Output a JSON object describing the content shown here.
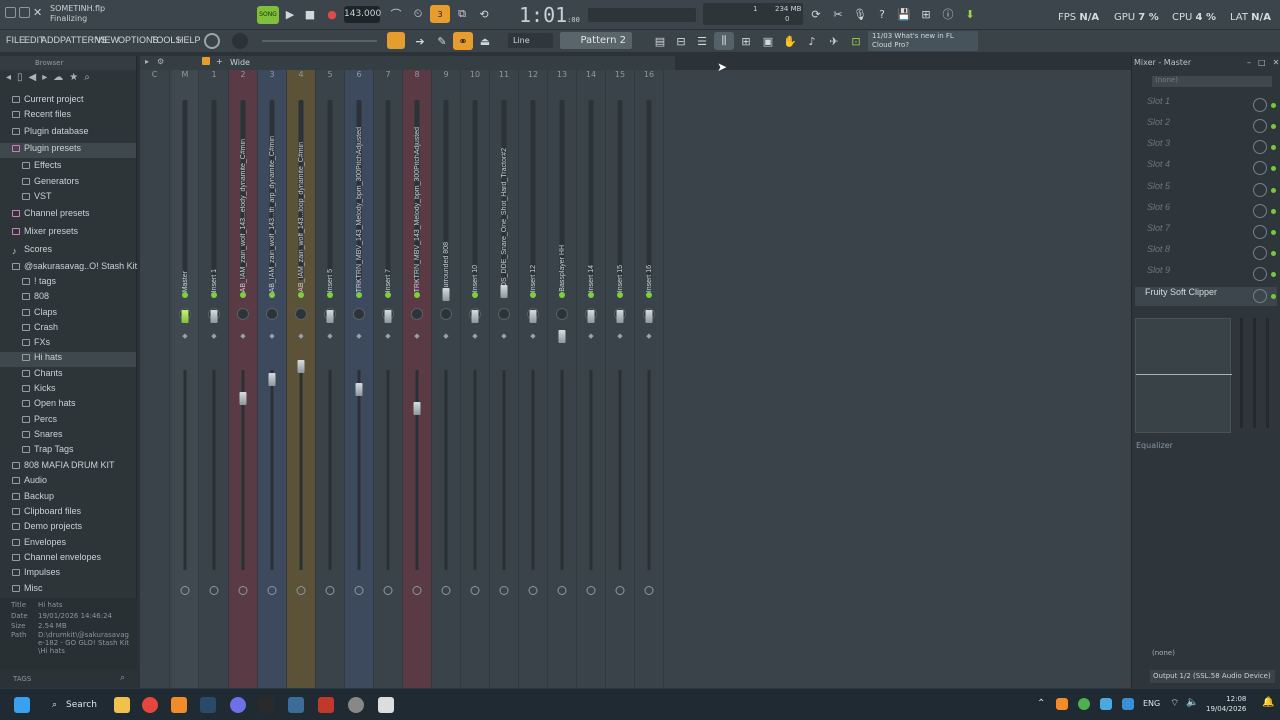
{
  "title": {
    "project": "SOMETINH.flp",
    "status": "Finalizing"
  },
  "transport": {
    "song_label": "SONG",
    "tempo": "143.000",
    "time": "1:01",
    "time_small": ":00",
    "cpu_value": "1",
    "mem": "234 MB",
    "voices": "0"
  },
  "meters": {
    "fps_label": "FPS",
    "fps": "N/A",
    "gpu_label": "GPU",
    "gpu": "7 %",
    "cpu_label": "CPU",
    "cpu": "4 %",
    "lat_label": "LAT",
    "lat": "N/A"
  },
  "menus": [
    "FILE",
    "EDIT",
    "ADD",
    "PATTERNS",
    "VIEW",
    "OPTIONS",
    "TOOLS",
    "HELP"
  ],
  "toolbar": {
    "snap": "Line",
    "pattern": "Pattern 2",
    "news_date": "11/03",
    "news_title": "What's new in FL",
    "news_sub": "Cloud Pro?"
  },
  "browser": {
    "title": "Browser",
    "items": [
      "Current project",
      "Recent files",
      "Plugin database",
      "Plugin presets",
      "Effects",
      "Generators",
      "VST",
      "Channel presets",
      "Mixer presets",
      "Scores",
      "@sakurasavag..O! Stash Kit",
      "! tags",
      "808",
      "Claps",
      "Crash",
      "FXs",
      "Hi hats",
      "Chants",
      "Kicks",
      "Open hats",
      "Percs",
      "Snares",
      "Trap Tags",
      "808 MAFIA DRUM KIT",
      "Audio",
      "Backup",
      "Clipboard files",
      "Demo projects",
      "Envelopes",
      "Channel envelopes",
      "Impulses",
      "Misc"
    ],
    "info": {
      "title_label": "Title",
      "title": "Hi hats",
      "date_label": "Date",
      "date": "19/01/2026 14:46:24",
      "size_label": "Size",
      "size": "2.54 MB",
      "path_label": "Path",
      "path": "D:\\drumkit\\@sakurasavage-182 - GO GLO! Stash Kit\\Hi hats"
    },
    "tags": "TAGS"
  },
  "mixer": {
    "view": "Wide",
    "channels": [
      {
        "num": "C",
        "name": ""
      },
      {
        "num": "M",
        "name": "Master"
      },
      {
        "num": "1",
        "name": "Insert 1"
      },
      {
        "num": "2",
        "name": "AB_IAM_zain_wolf_143...elody_dynamite_C#min"
      },
      {
        "num": "3",
        "name": "AB_IAM_zain_wolf_143...th_arp_dynamite_C#min"
      },
      {
        "num": "4",
        "name": "AB_IAM_zain_wolf_143...loop_dynamite_C#min"
      },
      {
        "num": "5",
        "name": "Insert 5"
      },
      {
        "num": "6",
        "name": "TRKTRN_MBV_143_Melody_bpm_300PitchAdjusted"
      },
      {
        "num": "7",
        "name": "Insert 7"
      },
      {
        "num": "8",
        "name": "TRKTRN_MBV_143_Melody_bpm_300PitchAdjusted"
      },
      {
        "num": "9",
        "name": "Surrounded 808"
      },
      {
        "num": "10",
        "name": "Insert 10"
      },
      {
        "num": "11",
        "name": "BOS_DDE_Snare_One_Shot_Hard_Tractor#2"
      },
      {
        "num": "12",
        "name": "Insert 12"
      },
      {
        "num": "13",
        "name": "Bassplayer HH"
      },
      {
        "num": "14",
        "name": "Insert 14"
      },
      {
        "num": "15",
        "name": "Insert 15"
      },
      {
        "num": "16",
        "name": "Insert 16"
      }
    ]
  },
  "mixer_master": {
    "title": "Mixer - Master",
    "input": "(none)",
    "slots": [
      "Slot 1",
      "Slot 2",
      "Slot 3",
      "Slot 4",
      "Slot 5",
      "Slot 6",
      "Slot 7",
      "Slot 8",
      "Slot 9"
    ],
    "active_fx": "Fruity Soft Clipper",
    "eq_label": "Equalizer",
    "send": "(none)",
    "output": "Output 1/2 (SSL.58 Audio Device)"
  },
  "taskbar": {
    "search": "Search",
    "lang": "ENG",
    "time": "12:08",
    "date": "19/04/2026"
  }
}
